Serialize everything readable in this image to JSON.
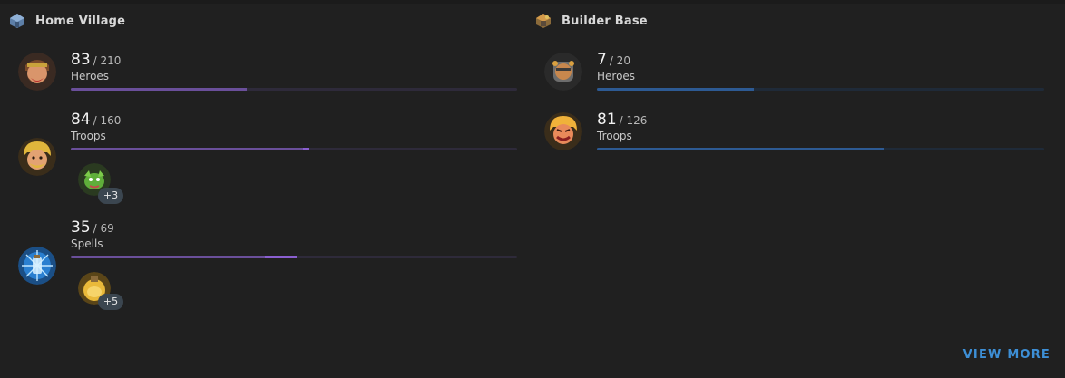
{
  "home_village": {
    "title": "Home Village",
    "icon": "home-village-icon",
    "rows": [
      {
        "icon": "barbarian-king-icon",
        "count": "83",
        "max": "/ 210",
        "label": "Heroes",
        "progress": 0.395,
        "progress_extra": 0
      },
      {
        "icon": "barbarian-icon",
        "count": "84",
        "max": "/ 160",
        "label": "Troops",
        "progress": 0.52,
        "progress_extra": 0.015,
        "extra_icon": "baby-dragon-icon",
        "extra_count": "+3"
      },
      {
        "icon": "lightning-spell-icon",
        "count": "35",
        "max": "/ 69",
        "label": "Spells",
        "progress": 0.435,
        "progress_extra": 0.072,
        "extra_icon": "rage-spell-icon",
        "extra_count": "+5"
      }
    ]
  },
  "builder_base": {
    "title": "Builder Base",
    "icon": "builder-base-icon",
    "rows": [
      {
        "icon": "battle-machine-icon",
        "count": "7",
        "max": "/ 20",
        "label": "Heroes",
        "progress": 0.35
      },
      {
        "icon": "raged-barbarian-icon",
        "count": "81",
        "max": "/ 126",
        "label": "Troops",
        "progress": 0.643
      }
    ]
  },
  "footer": {
    "view_more": "VIEW MORE"
  },
  "colors": {
    "background": "#202020",
    "purple_bar": "#6a4f9a",
    "purple_highlight": "#8a5fd0",
    "blue_bar": "#2d5a93",
    "link": "#3d8fd6"
  }
}
